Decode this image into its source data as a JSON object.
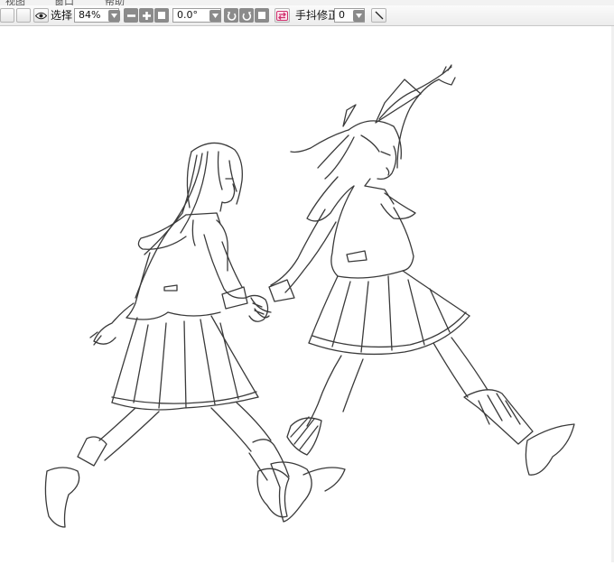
{
  "menu": {
    "items": [
      "视图",
      "窗口",
      "帮助"
    ]
  },
  "toolbar": {
    "select_label": "选择",
    "zoom_value": "84%",
    "rotation_value": "0.0°",
    "stabilizer_label": "手抖修正",
    "stabilizer_value": "0"
  },
  "icons": {
    "eye": "eye-icon",
    "zoom_dropdown": "chevron-down-icon",
    "zoom_out": "minus-icon",
    "zoom_in": "plus-icon",
    "zoom_reset": "square-icon",
    "rotate_ccw": "rotate-left-icon",
    "rotate_cw": "rotate-right-icon",
    "rotate_reset": "square-icon",
    "flip": "flip-icon",
    "line_tool": "line-icon"
  },
  "colors": {
    "toolbar_bg": "#f2f2f2",
    "button_dark": "#8b8b8b",
    "flip_accent": "#d0306e",
    "canvas_bg": "#ffffff",
    "sketch_stroke": "#3a3a3a"
  },
  "canvas": {
    "artwork": "line-art-sketch"
  }
}
